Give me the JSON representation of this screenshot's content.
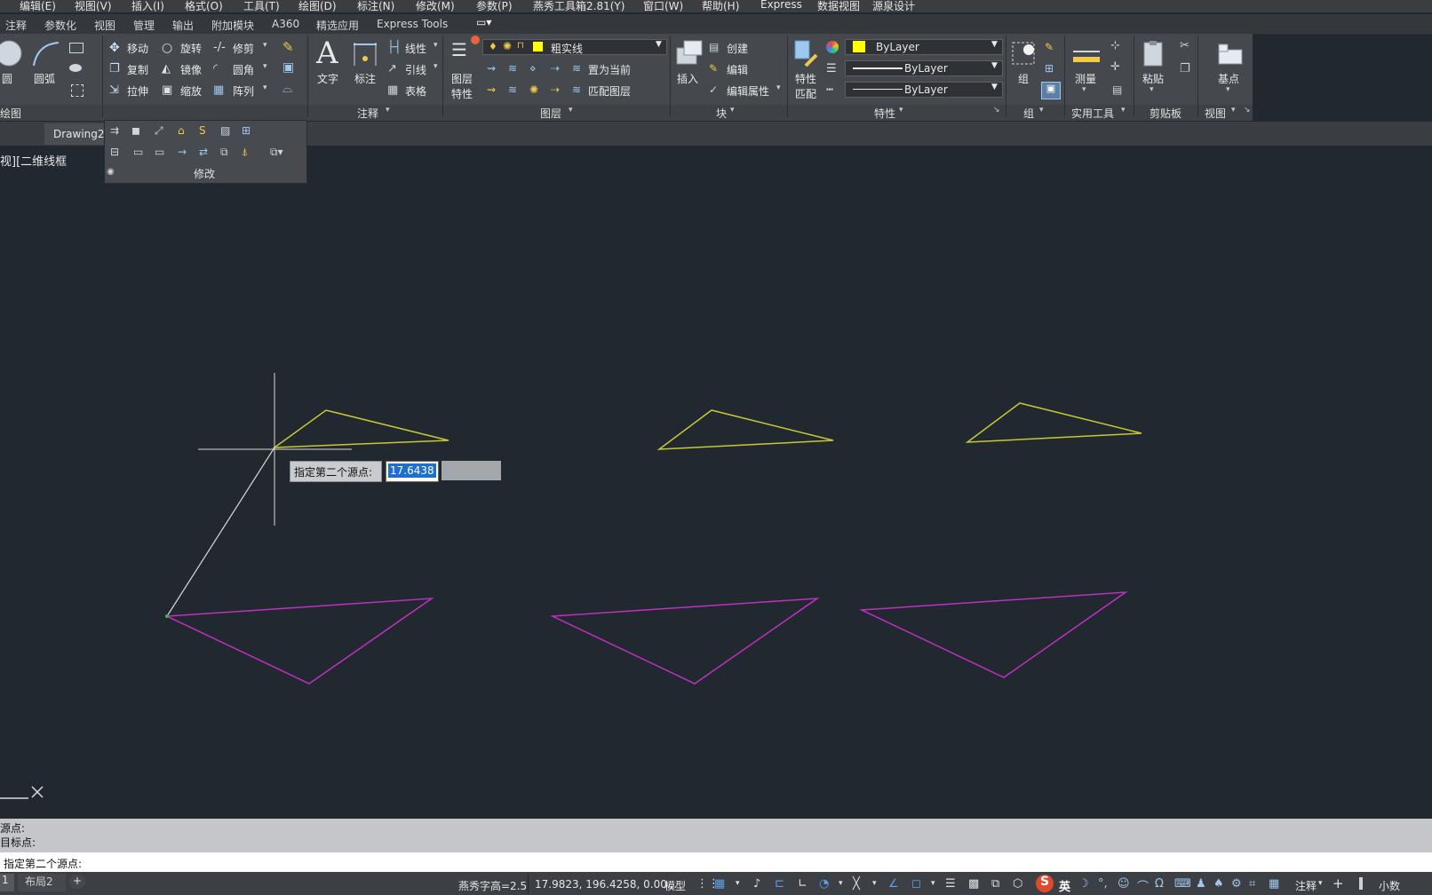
{
  "menubar": {
    "items": [
      "编辑(E)",
      "视图(V)",
      "插入(I)",
      "格式(O)",
      "工具(T)",
      "绘图(D)",
      "标注(N)",
      "修改(M)",
      "参数(P)",
      "燕秀工具箱2.81(Y)",
      "窗口(W)",
      "帮助(H)",
      "Express",
      "数据视图",
      "源泉设计"
    ]
  },
  "ribbon_tabs": [
    "注释",
    "参数化",
    "视图",
    "管理",
    "输出",
    "附加模块",
    "A360",
    "精选应用",
    "Express Tools"
  ],
  "ribbon": {
    "draw": {
      "circle": "圆",
      "arc": "圆弧",
      "title": "绘图"
    },
    "modify": {
      "move": "移动",
      "rotate": "旋转",
      "trim": "修剪",
      "copy": "复制",
      "mirror": "镜像",
      "fillet": "圆角",
      "stretch": "拉伸",
      "scale": "缩放",
      "array": "阵列",
      "title": "修改"
    },
    "annotation": {
      "text": "文字",
      "dim": "标注",
      "linear": "线性",
      "leader": "引线",
      "table": "表格",
      "title": "注释"
    },
    "layers": {
      "props_l1": "图层",
      "props_l2": "特性",
      "current_layer": "粗实线",
      "set_current": "置为当前",
      "match_layer": "匹配图层",
      "title": "图层"
    },
    "block": {
      "insert": "插入",
      "create": "创建",
      "edit": "编辑",
      "edit_attr": "编辑属性",
      "title": "块"
    },
    "properties": {
      "match_l1": "特性",
      "match_l2": "匹配",
      "color": "ByLayer",
      "linetype": "ByLayer",
      "lineweight": "ByLayer",
      "title": "特性"
    },
    "group": {
      "group": "组",
      "title": "组"
    },
    "utilities": {
      "measure": "测量",
      "title": "实用工具"
    },
    "clipboard": {
      "paste": "粘贴",
      "title": "剪贴板"
    },
    "view": {
      "base": "基点",
      "title": "视图"
    }
  },
  "doc_tab": "Drawing2",
  "viewport_label": "视][二维线框",
  "dynamic_input": {
    "prompt": "指定第二个源点:",
    "value": "17.6438"
  },
  "command": {
    "history": [
      "源点:",
      "目标点:"
    ],
    "prompt": "指定第二个源点:"
  },
  "status": {
    "layout_tabs": [
      "1",
      "布局2",
      "+"
    ],
    "text_height": "燕秀字高=2.5",
    "coords": "17.9823, 196.4258, 0.00...",
    "model": "模型",
    "annotation": "注释",
    "units": "小数",
    "ime": "英"
  },
  "colors": {
    "canvas": "#212830",
    "yellow_lines": "#c8c832",
    "magenta_lines": "#c030c0",
    "rubber_band": "#d9d9d9",
    "layer_swatch": "#ffff00"
  }
}
